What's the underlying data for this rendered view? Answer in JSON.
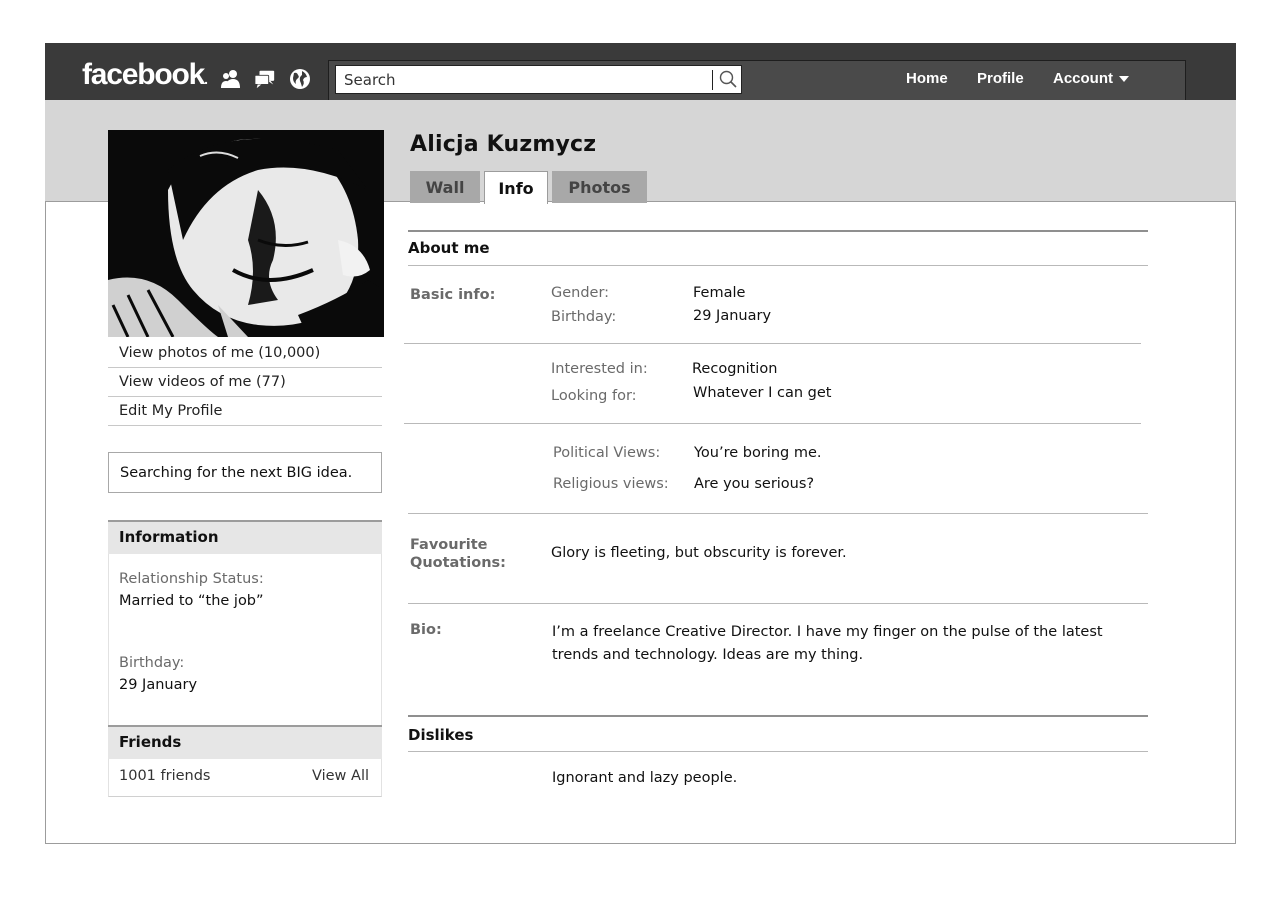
{
  "topbar": {
    "logo": "facebook",
    "search_placeholder": "Search",
    "nav": {
      "home": "Home",
      "profile": "Profile",
      "account": "Account"
    }
  },
  "profile": {
    "name": "Alicja Kuzmycz",
    "tabs": [
      {
        "label": "Wall",
        "active": false
      },
      {
        "label": "Info",
        "active": true
      },
      {
        "label": "Photos",
        "active": false
      }
    ]
  },
  "sidebar": {
    "links": [
      "View photos of me (10,000)",
      "View videos of me (77)",
      "Edit My Profile"
    ],
    "status": "Searching for the next BIG idea.",
    "information": {
      "title": "Information",
      "relationship_label": "Relationship Status:",
      "relationship_value": "Married to “the job”",
      "birthday_label": "Birthday:",
      "birthday_value": "29 January"
    },
    "friends": {
      "title": "Friends",
      "count": "1001 friends",
      "view_all": "View All"
    }
  },
  "info": {
    "about_title": "About me",
    "basic_info_label": "Basic info:",
    "gender_label": "Gender:",
    "gender_value": "Female",
    "birthday_label": "Birthday:",
    "birthday_value": "29 January",
    "interested_label": "Interested in:",
    "interested_value": "Recognition",
    "looking_label": "Looking for:",
    "looking_value": "Whatever I can get",
    "political_label": "Political Views:",
    "political_value": "You’re boring me.",
    "religious_label": "Religious views:",
    "religious_value": "Are you serious?",
    "quotes_label_1": "Favourite",
    "quotes_label_2": "Quotations:",
    "quotes_value": "Glory is fleeting, but obscurity is forever.",
    "bio_label": "Bio:",
    "bio_line1": "I’m a freelance Creative Director. I have my finger on the pulse of the latest",
    "bio_line2": "trends and technology. Ideas are my thing.",
    "dislikes_title": "Dislikes",
    "dislikes_value": "Ignorant and lazy people."
  }
}
